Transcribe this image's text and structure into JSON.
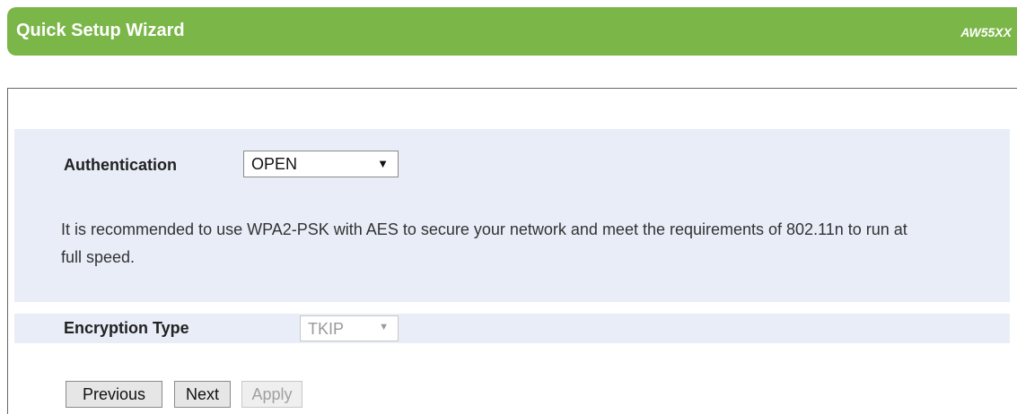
{
  "header": {
    "title": "Quick Setup Wizard",
    "model": "AW55XX",
    "color": "#7ab648"
  },
  "authentication": {
    "label": "Authentication",
    "selected": "OPEN",
    "arrow": "▼"
  },
  "note": "It is recommended to use WPA2-PSK with AES to secure your network and meet the requirements of 802.11n to run at full speed.",
  "encryption": {
    "label": "Encryption Type",
    "selected": "TKIP",
    "arrow": "▼",
    "disabled": true
  },
  "buttons": {
    "previous": "Previous",
    "next": "Next",
    "apply": "Apply"
  }
}
